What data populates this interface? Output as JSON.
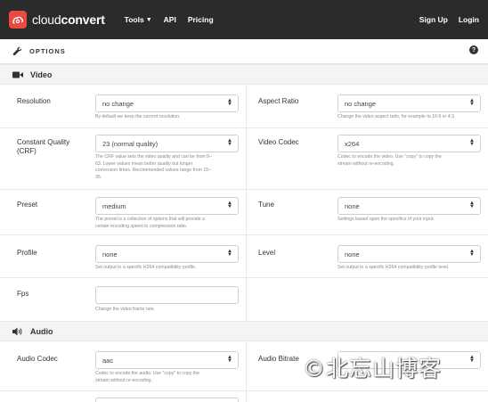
{
  "nav": {
    "logo": {
      "light": "cloud",
      "bold": "convert"
    },
    "tools": "Tools",
    "api": "API",
    "pricing": "Pricing",
    "signup": "Sign Up",
    "login": "Login"
  },
  "options": {
    "title": "OPTIONS",
    "help": "?"
  },
  "video": {
    "title": "Video",
    "resolution": {
      "label": "Resolution",
      "value": "no change",
      "help": "By default we keep the current resolution."
    },
    "aspect": {
      "label": "Aspect Ratio",
      "value": "no change",
      "help": "Change the video aspect ratio, for example to 16:9 or 4:3."
    },
    "crf": {
      "label1": "Constant Quality",
      "label2": "(CRF)",
      "value": "23 (normal quality)",
      "help1": "The CRF value sets the video quality and can be from 0–",
      "help2": "63. Lower values mean better quality but longer",
      "help3": "conversion times. Recommended values range from 15–",
      "help4": "35."
    },
    "codec": {
      "label": "Video Codec",
      "value": "x264",
      "help1": "Codec to encode the video. Use \"copy\" to copy the",
      "help2": "stream without re-encoding."
    },
    "preset": {
      "label": "Preset",
      "value": "medium",
      "help1": "The preset is a collection of options that will provide a",
      "help2": "certain encoding speed to compression ratio."
    },
    "tune": {
      "label": "Tune",
      "value": "none",
      "help": "Settings based upon the specifics of your input."
    },
    "profile": {
      "label": "Profile",
      "value": "none",
      "help": "Set output to a specific H264 compatibility profile."
    },
    "level": {
      "label": "Level",
      "value": "none",
      "help": "Set output to a specific H264 compatibility profile level."
    },
    "fps": {
      "label": "Fps",
      "value": "",
      "help": "Change the video frame rate."
    }
  },
  "audio": {
    "title": "Audio",
    "codec": {
      "label": "Audio Codec",
      "value": "aac",
      "help1": "Codec to encode the audio. Use \"copy\" to copy the",
      "help2": "stream without re-encoding."
    },
    "bitrate": {
      "label": "Audio Bitrate"
    }
  },
  "watermark": "©北忘山博客"
}
